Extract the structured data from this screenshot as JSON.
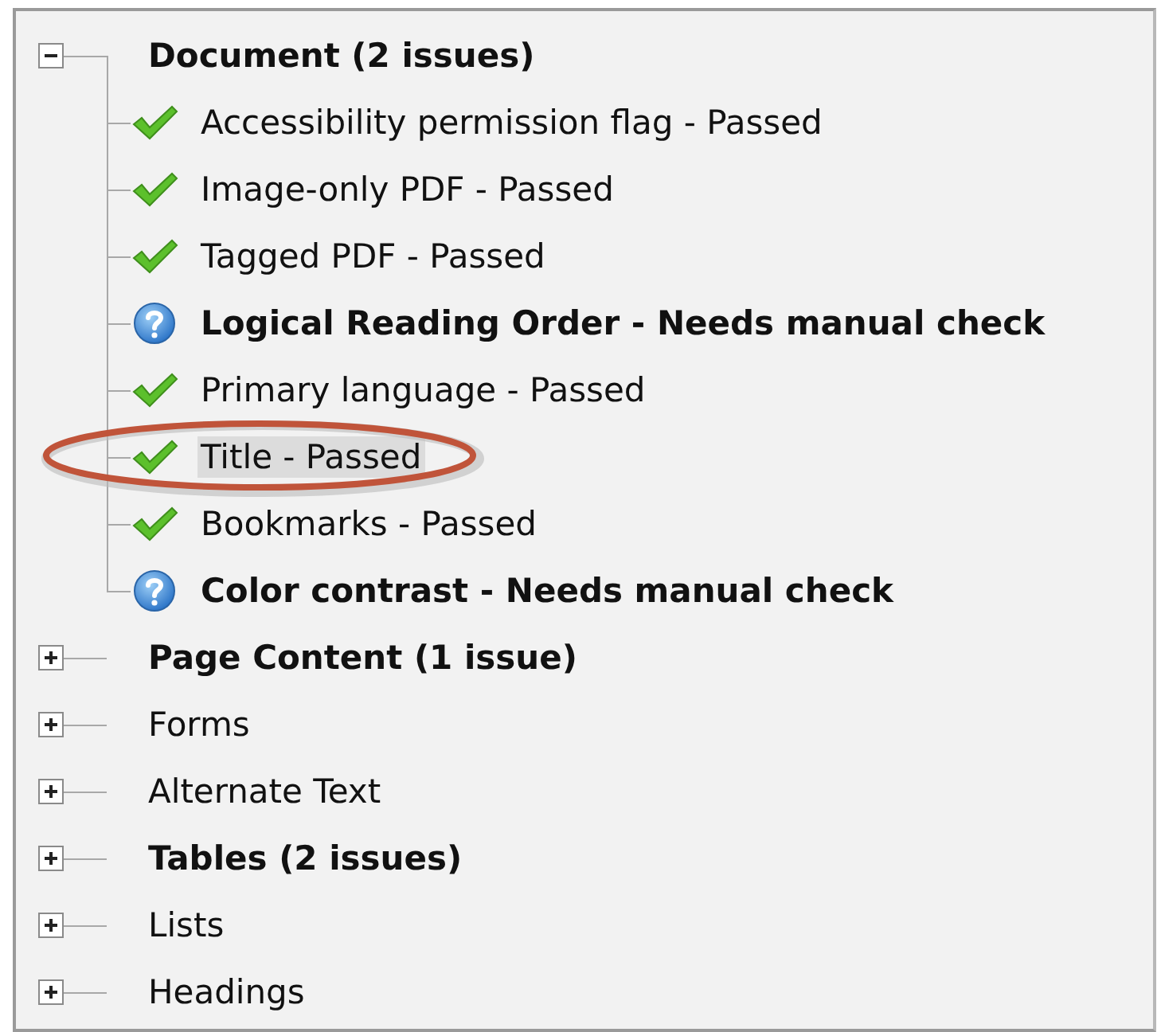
{
  "groups": [
    {
      "label": "Document (2 issues)",
      "issues": true,
      "expanded": true,
      "children": [
        {
          "label": "Accessibility permission flag - Passed",
          "kind": "passed",
          "selected": false,
          "circled": false
        },
        {
          "label": "Image-only PDF - Passed",
          "kind": "passed",
          "selected": false,
          "circled": false
        },
        {
          "label": "Tagged PDF - Passed",
          "kind": "passed",
          "selected": false,
          "circled": false
        },
        {
          "label": "Logical Reading Order - Needs manual check",
          "kind": "manual",
          "selected": false,
          "circled": false
        },
        {
          "label": "Primary language - Passed",
          "kind": "passed",
          "selected": false,
          "circled": false
        },
        {
          "label": "Title - Passed",
          "kind": "passed",
          "selected": true,
          "circled": true
        },
        {
          "label": "Bookmarks - Passed",
          "kind": "passed",
          "selected": false,
          "circled": false
        },
        {
          "label": "Color contrast - Needs manual check",
          "kind": "manual",
          "selected": false,
          "circled": false
        }
      ]
    },
    {
      "label": "Page Content (1 issue)",
      "issues": true,
      "expanded": false
    },
    {
      "label": "Forms",
      "issues": false,
      "expanded": false
    },
    {
      "label": "Alternate Text",
      "issues": false,
      "expanded": false
    },
    {
      "label": "Tables (2 issues)",
      "issues": true,
      "expanded": false
    },
    {
      "label": "Lists",
      "issues": false,
      "expanded": false
    },
    {
      "label": "Headings",
      "issues": false,
      "expanded": false
    }
  ]
}
